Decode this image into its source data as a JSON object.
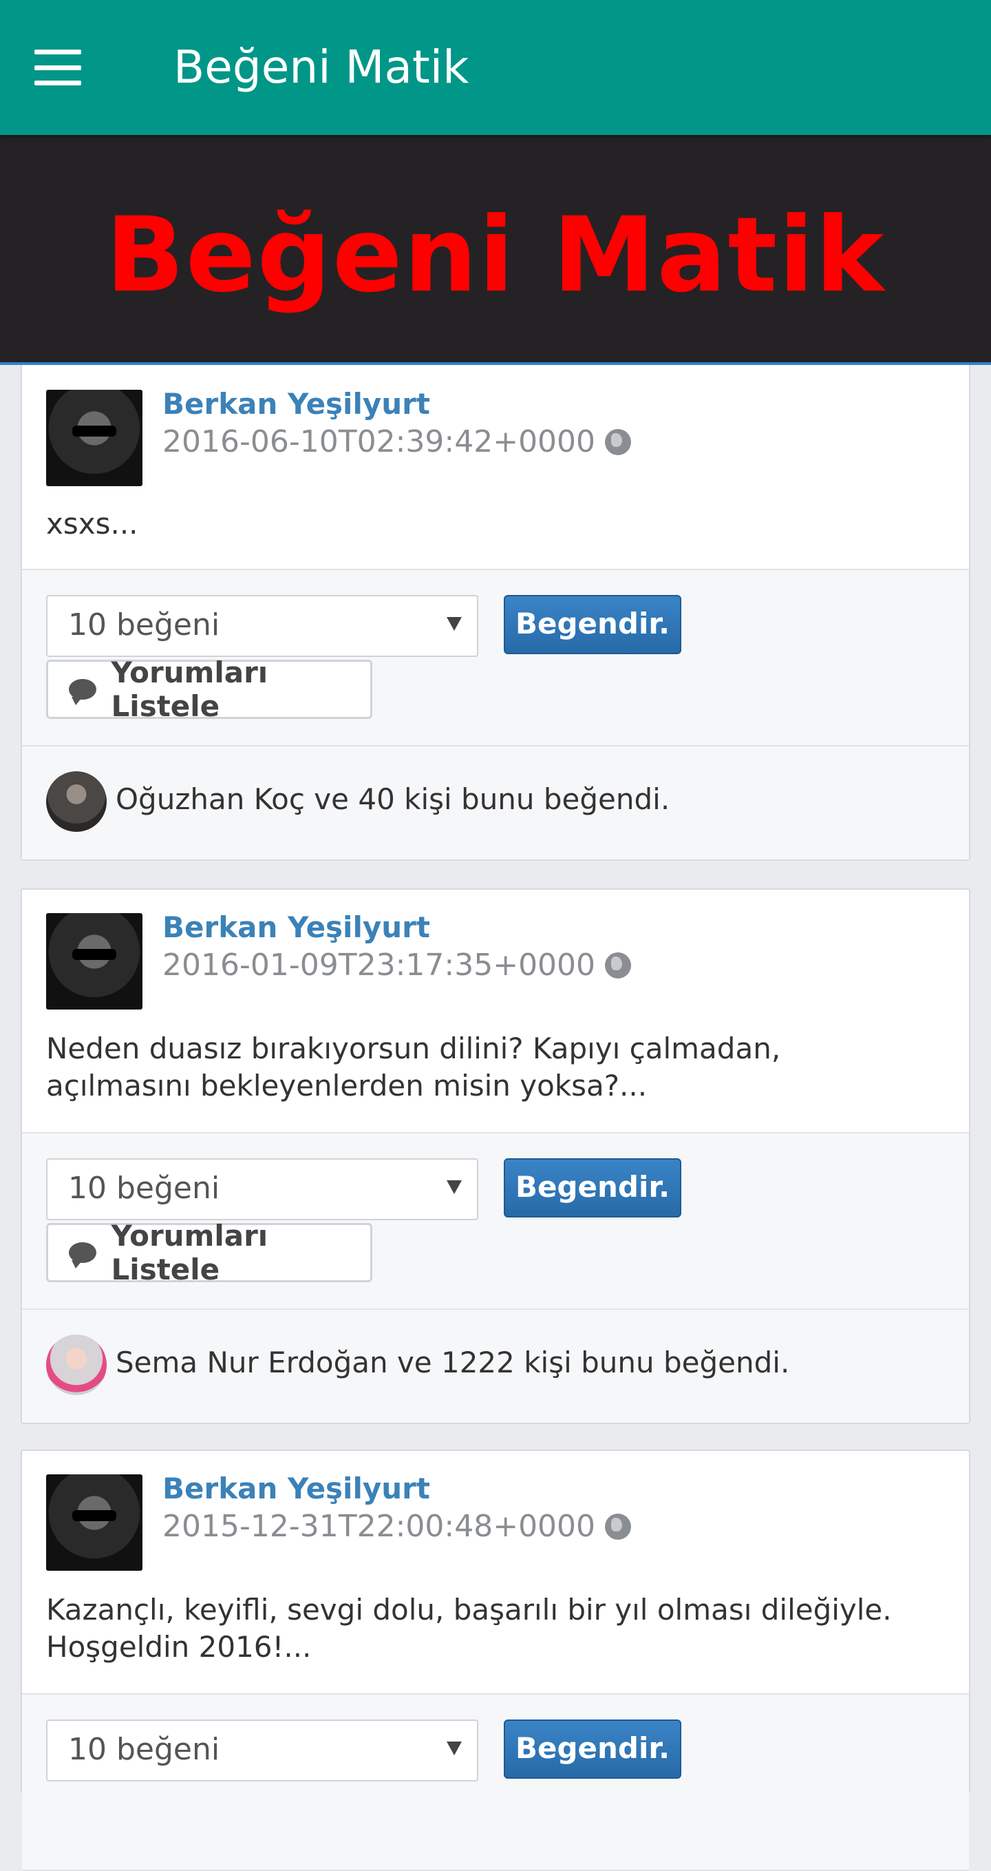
{
  "appbar": {
    "title": "Beğeni Matik"
  },
  "banner": {
    "text": "Beğeni Matik"
  },
  "posts": [
    {
      "author": "Berkan Yeşilyurt",
      "time": "2016-06-10T02:39:42+0000",
      "message": "xsxs...",
      "select_value": "10 beğeni",
      "like_button": "Begendir.",
      "comments_button": "Yorumları Listele",
      "likes_text": "Oğuzhan Koç ve 40 kişi bunu beğendi."
    },
    {
      "author": "Berkan Yeşilyurt",
      "time": "2016-01-09T23:17:35+0000",
      "message": "Neden duasız bırakıyorsun dilini? Kapıyı çalmadan, açılmasını bekleyenlerden misin yoksa?...",
      "select_value": "10 beğeni",
      "like_button": "Begendir.",
      "comments_button": "Yorumları Listele",
      "likes_text": "Sema Nur Erdoğan ve 1222 kişi bunu beğendi."
    },
    {
      "author": "Berkan Yeşilyurt",
      "time": "2015-12-31T22:00:48+0000",
      "message": "Kazançlı, keyifli, sevgi dolu, başarılı bir yıl olması dileğiyle. Hoşgeldin 2016!...",
      "select_value": "10 beğeni",
      "like_button": "Begendir."
    }
  ]
}
